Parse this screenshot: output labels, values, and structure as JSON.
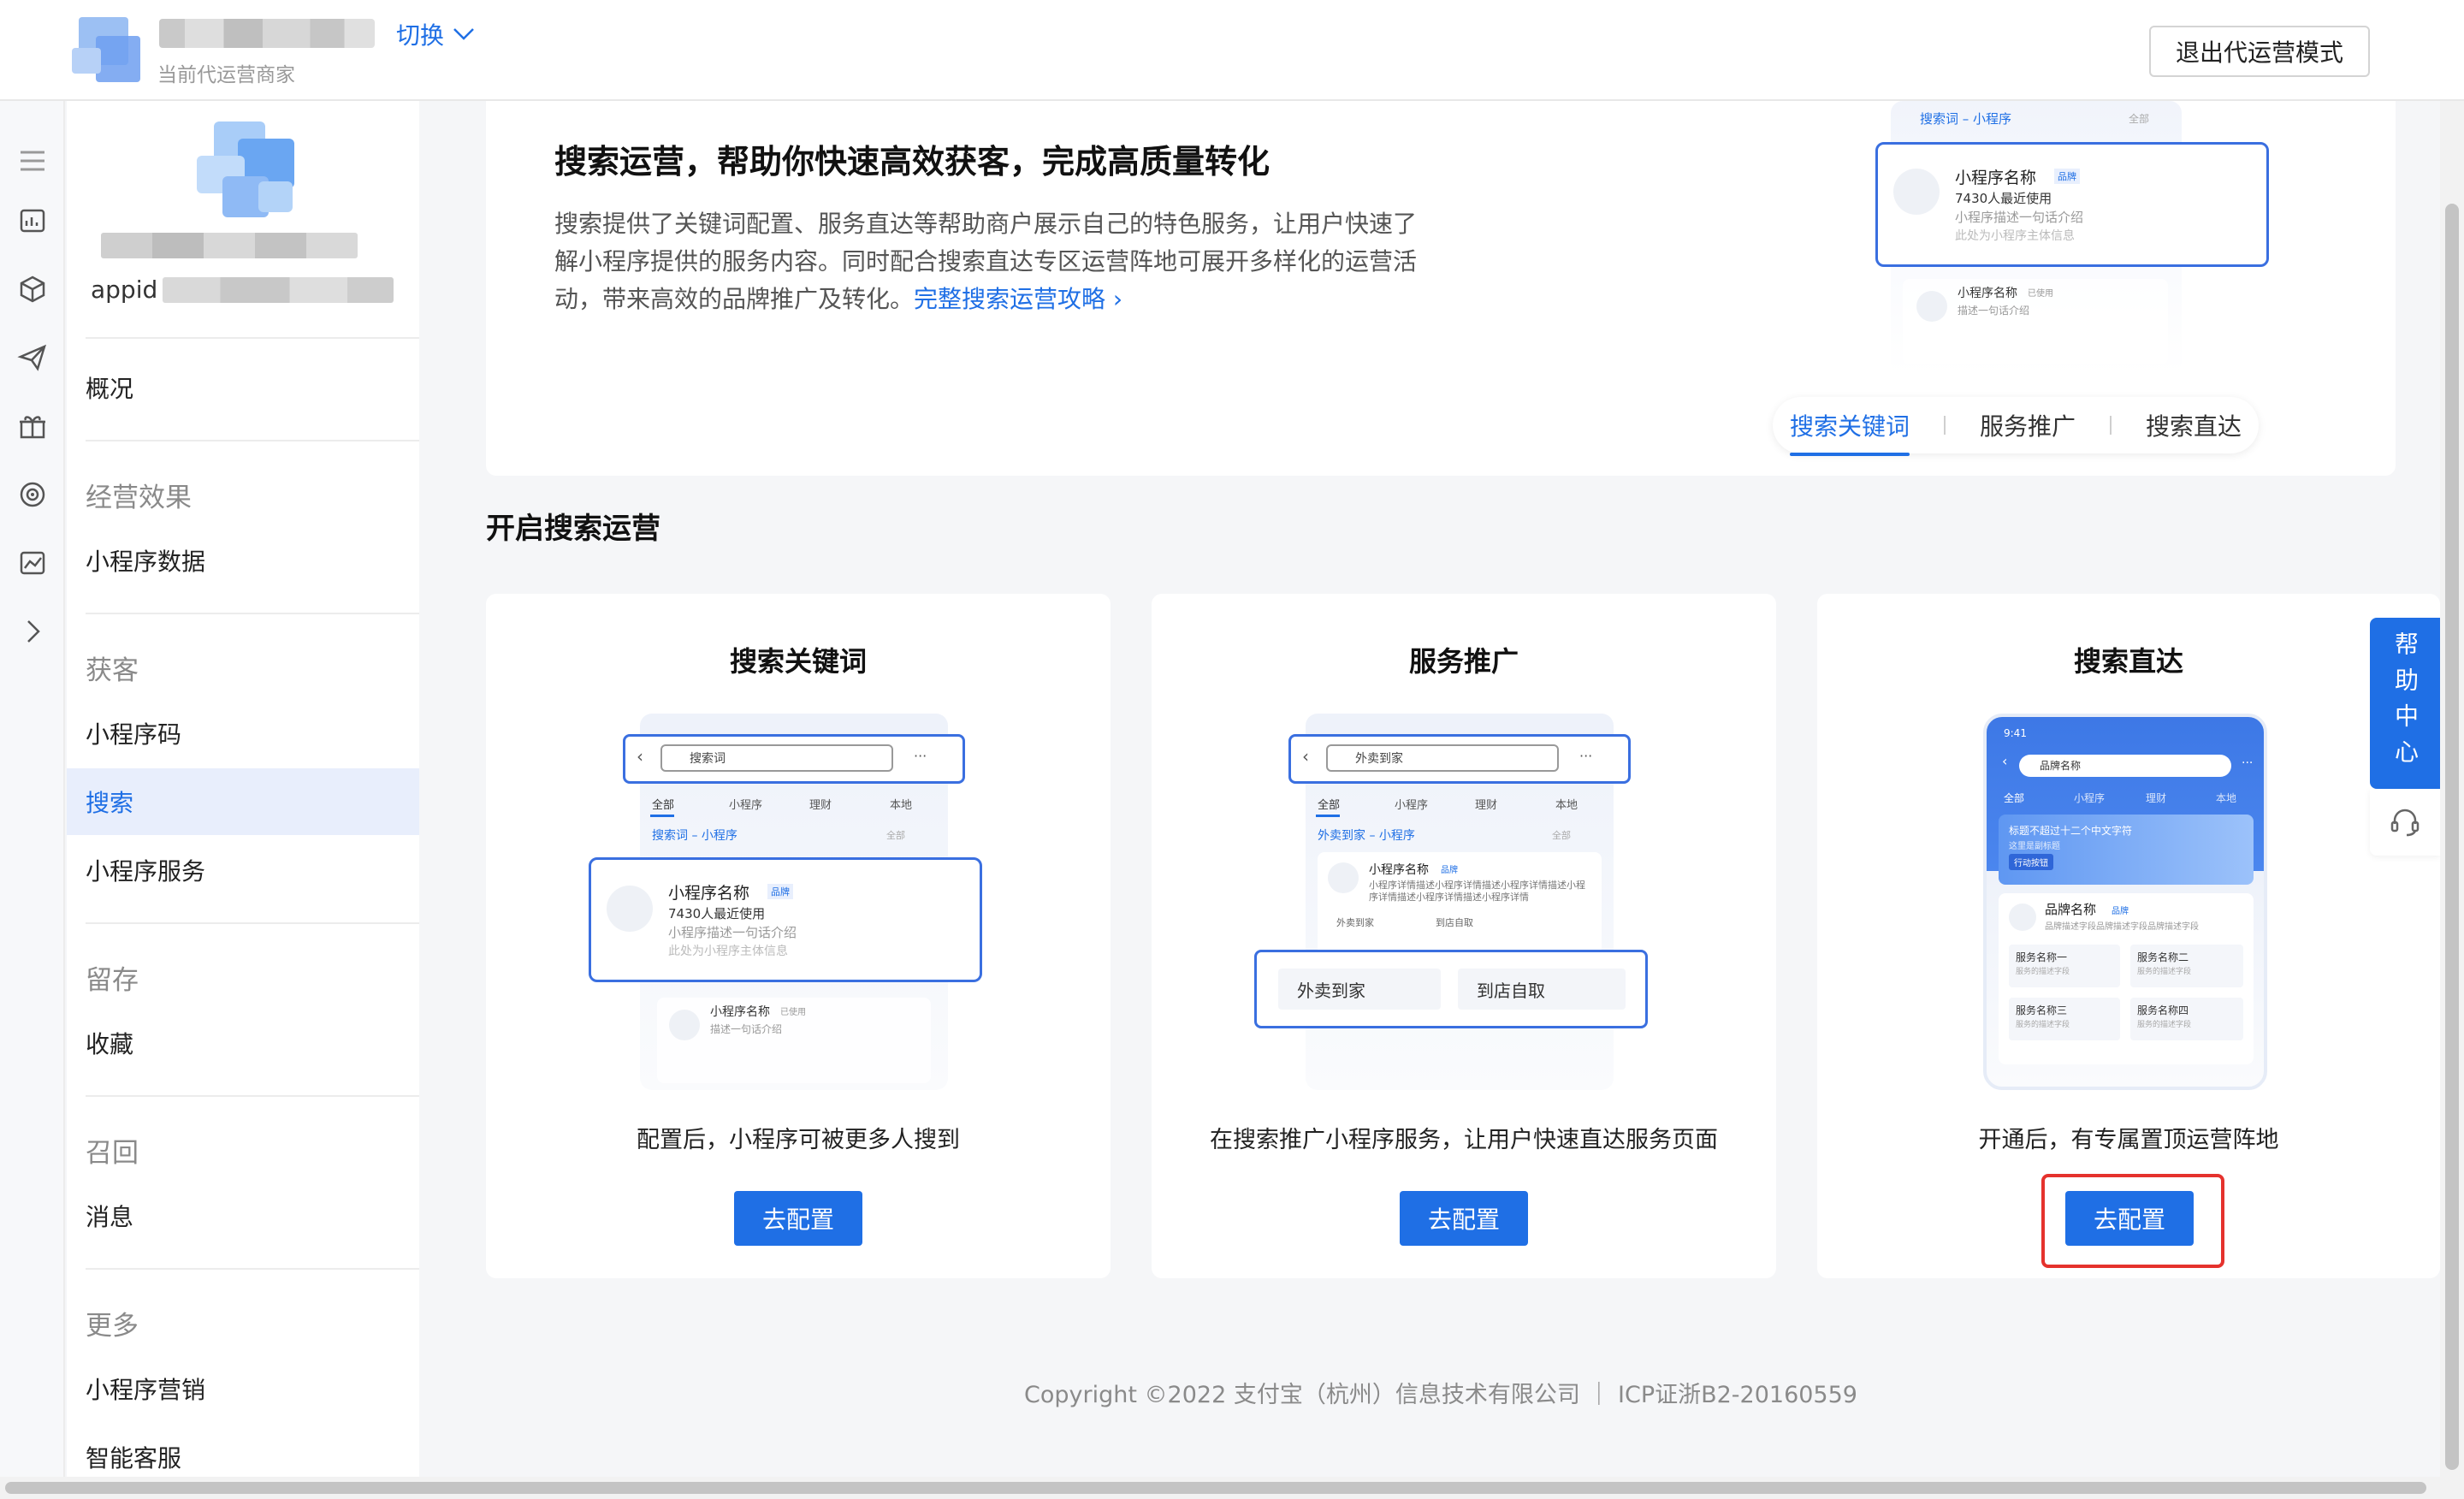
{
  "header": {
    "switch_label": "切换",
    "merchant_sub": "当前代运营商家",
    "exit_label": "退出代运营模式"
  },
  "sidebar": {
    "appid_prefix": "appid",
    "overview": "概况",
    "groups": {
      "effect": "经营效果",
      "acquire": "获客",
      "retain": "留存",
      "recall": "召回",
      "more": "更多"
    },
    "items": {
      "mini_data": "小程序数据",
      "mini_code": "小程序码",
      "search": "搜索",
      "mini_service": "小程序服务",
      "favorite": "收藏",
      "message": "消息",
      "mini_marketing": "小程序营销",
      "smart_service": "智能客服"
    }
  },
  "intro": {
    "title": "搜索运营，帮助你快速高效获客，完成高质量转化",
    "desc": "搜索提供了关键词配置、服务直达等帮助商户展示自己的特色服务，让用户快速了解小程序提供的服务内容。同时配合搜索直达专区运营阵地可展开多样化的运营活动，带来高效的品牌推广及转化。",
    "link": "完整搜索运营攻略",
    "tabs": [
      "搜索关键词",
      "服务推广",
      "搜索直达"
    ],
    "mock": {
      "keyword_line": "搜索词 – 小程序",
      "all": "全部",
      "name": "小程序名称",
      "brand": "品牌",
      "users": "7430人最近使用",
      "slogan": "小程序描述一句话介绍",
      "subject": "此处为小程序主体信息",
      "used": "已使用",
      "desc2": "描述一句话介绍"
    }
  },
  "section_title": "开启搜索运营",
  "features": [
    {
      "title": "搜索关键词",
      "desc": "配置后，小程序可被更多人搜到",
      "button": "去配置",
      "mock": {
        "search": "搜索词",
        "tabs": [
          "全部",
          "小程序",
          "理财",
          "本地"
        ],
        "line": "搜索词 – 小程序",
        "all": "全部",
        "name": "小程序名称",
        "brand": "品牌",
        "users": "7430人最近使用",
        "slogan": "小程序描述一句话介绍",
        "subject": "此处为小程序主体信息",
        "name2": "小程序名称",
        "used": "已使用",
        "desc2": "描述一句话介绍"
      }
    },
    {
      "title": "服务推广",
      "desc": "在搜索推广小程序服务，让用户快速直达服务页面",
      "button": "去配置",
      "mock": {
        "search": "外卖到家",
        "tabs": [
          "全部",
          "小程序",
          "理财",
          "本地"
        ],
        "line": "外卖到家 – 小程序",
        "all": "全部",
        "name": "小程序名称",
        "brand": "品牌",
        "detail": "小程序详情描述小程序详情描述小程序详情描述小程序详情描述小程序详情描述小程序详情",
        "svc1": "外卖到家",
        "svc2": "到店自取"
      }
    },
    {
      "title": "搜索直达",
      "desc": "开通后，有专属置顶运营阵地",
      "button": "去配置",
      "mock": {
        "time": "9:41",
        "search": "品牌名称",
        "tabs": [
          "全部",
          "小程序",
          "理财",
          "本地"
        ],
        "banner": "标题不超过十二个中文字符",
        "banner_sub": "这里是副标题",
        "banner_btn": "行动按钮",
        "brand": "品牌名称",
        "brand_tag": "品牌",
        "brand_desc": "品牌描述字段品牌描述字段品牌描述字段",
        "services": [
          "服务名称一",
          "服务名称二",
          "服务名称三",
          "服务名称四"
        ],
        "svc_desc": "服务的描述字段"
      }
    }
  ],
  "help": {
    "label": "帮助中心"
  },
  "footer": "Copyright ©2022 支付宝（杭州）信息技术有限公司 ｜ ICP证浙B2-20160559",
  "colors": {
    "accent": "#1f6fe5",
    "highlight": "#e5322d",
    "active_bg": "#e8eefc"
  }
}
